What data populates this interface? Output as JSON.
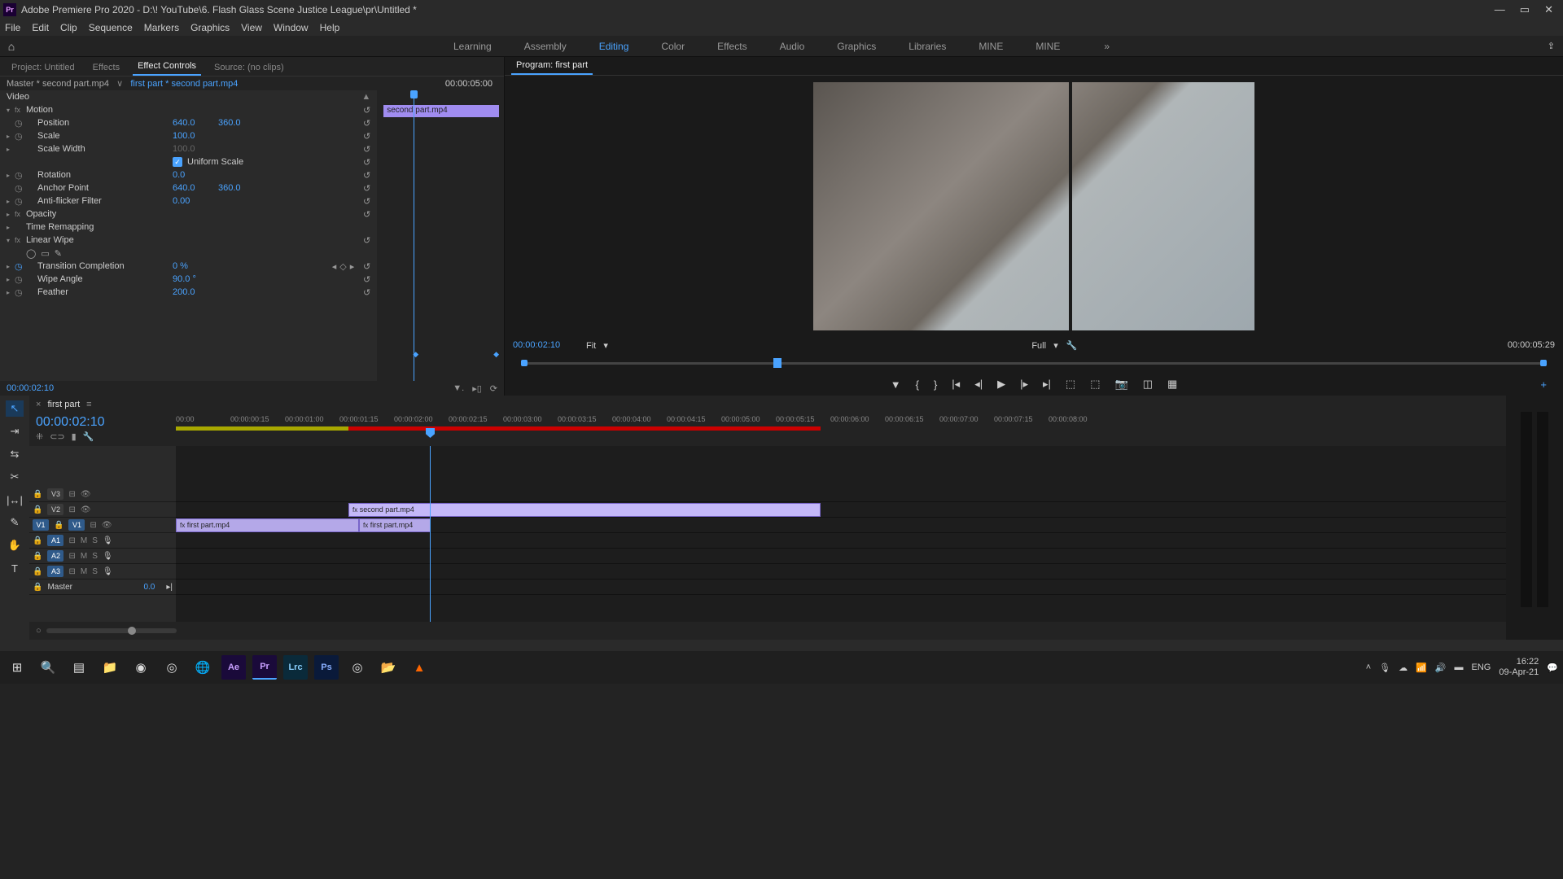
{
  "titlebar": {
    "app": "Pr",
    "text": "Adobe Premiere Pro 2020 - D:\\! YouTube\\6. Flash Glass Scene Justice League\\pr\\Untitled *"
  },
  "menu": [
    "File",
    "Edit",
    "Clip",
    "Sequence",
    "Markers",
    "Graphics",
    "View",
    "Window",
    "Help"
  ],
  "workspaces": [
    "Learning",
    "Assembly",
    "Editing",
    "Color",
    "Effects",
    "Audio",
    "Graphics",
    "Libraries",
    "MINE",
    "MINE"
  ],
  "workspace_active": "Editing",
  "ec_tabs": [
    "Project: Untitled",
    "Effects",
    "Effect Controls",
    "Source: (no clips)"
  ],
  "ec_active_tab": "Effect Controls",
  "ec_master": "Master * second part.mp4",
  "ec_clip": "first part * second part.mp4",
  "ec_duration": "00:00:05:00",
  "ec_mini_clip": "second part.mp4",
  "ec": {
    "video": "Video",
    "motion": "Motion",
    "position": "Position",
    "pos_x": "640.0",
    "pos_y": "360.0",
    "scale": "Scale",
    "scale_v": "100.0",
    "scale_w": "Scale Width",
    "scale_w_v": "100.0",
    "uniform": "Uniform Scale",
    "rotation": "Rotation",
    "rotation_v": "0.0",
    "anchor": "Anchor Point",
    "anchor_x": "640.0",
    "anchor_y": "360.0",
    "antiflicker": "Anti-flicker Filter",
    "antiflicker_v": "0.00",
    "opacity": "Opacity",
    "timeremap": "Time Remapping",
    "linear": "Linear Wipe",
    "trans": "Transition Completion",
    "trans_v": "0 %",
    "wipe": "Wipe Angle",
    "wipe_v": "90.0 °",
    "feather": "Feather",
    "feather_v": "200.0"
  },
  "ec_time": "00:00:02:10",
  "prog_tab": "Program: first part",
  "prog_time_l": "00:00:02:10",
  "prog_fit": "Fit",
  "prog_full": "Full",
  "prog_time_r": "00:00:05:29",
  "tl_tab": "first part",
  "tl_time": "00:00:02:10",
  "ruler": [
    "00:00",
    "00:00:00:15",
    "00:00:01:00",
    "00:00:01:15",
    "00:00:02:00",
    "00:00:02:15",
    "00:00:03:00",
    "00:00:03:15",
    "00:00:04:00",
    "00:00:04:15",
    "00:00:05:00",
    "00:00:05:15",
    "00:00:06:00",
    "00:00:06:15",
    "00:00:07:00",
    "00:00:07:15",
    "00:00:08:00"
  ],
  "tracks_v": [
    "V3",
    "V2",
    "V1"
  ],
  "tracks_a": [
    "A1",
    "A2",
    "A3"
  ],
  "master": "Master",
  "master_db": "0.0",
  "clip_v2": "second part.mp4",
  "clip_v1a": "first part.mp4",
  "clip_v1b": "first part.mp4",
  "tray": {
    "lang": "ENG",
    "time": "16:22",
    "date": "09-Apr-21"
  }
}
